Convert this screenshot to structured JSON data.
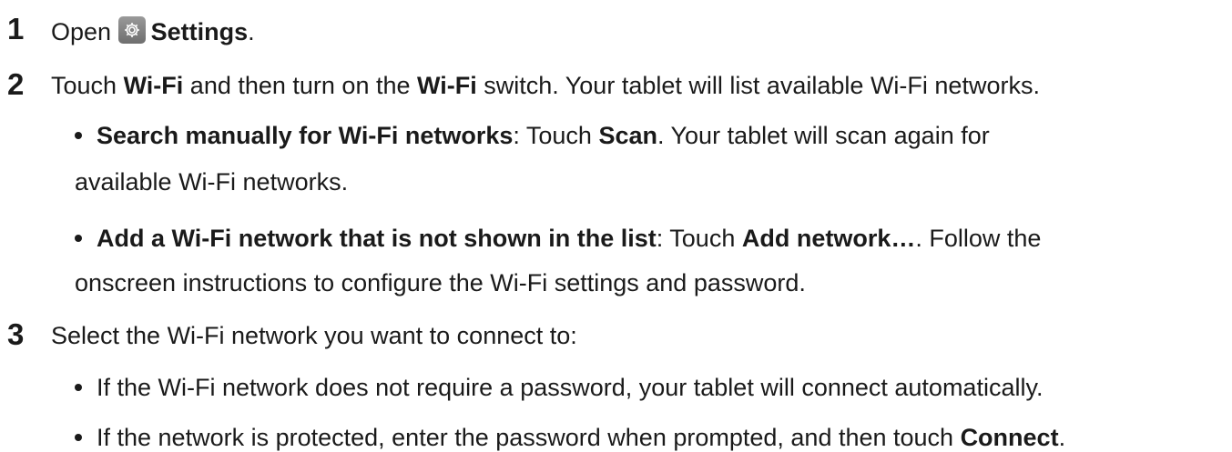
{
  "steps": [
    {
      "number": "1",
      "open": "Open",
      "settings": "Settings",
      "period": "."
    },
    {
      "number": "2",
      "touch": "Touch ",
      "wifi": "Wi-Fi",
      "then": " and then turn on the ",
      "wifi2": "Wi-Fi",
      "rest": " switch. Your tablet will list available Wi-Fi networks.",
      "bullets": [
        {
          "bold": "Search manually for Wi-Fi networks",
          "mid": ": Touch ",
          "bold2": "Scan",
          "rest": ". Your tablet will scan again for",
          "cont": "available Wi-Fi networks."
        },
        {
          "bold": "Add a Wi-Fi network that is not shown in the list",
          "mid": ": Touch ",
          "bold2": "Add network…",
          "rest": ". Follow the",
          "cont": "onscreen instructions to configure the Wi-Fi settings and password."
        }
      ]
    },
    {
      "number": "3",
      "text": "Select the Wi-Fi network you want to connect to:",
      "bullets": [
        {
          "text": "If the Wi-Fi network does not require a password, your tablet will connect automatically."
        },
        {
          "text": "If the network is protected, enter the password when prompted, and then touch ",
          "bold": "Connect",
          "end": "."
        }
      ]
    }
  ],
  "icons": {
    "settings": "gear-icon"
  }
}
